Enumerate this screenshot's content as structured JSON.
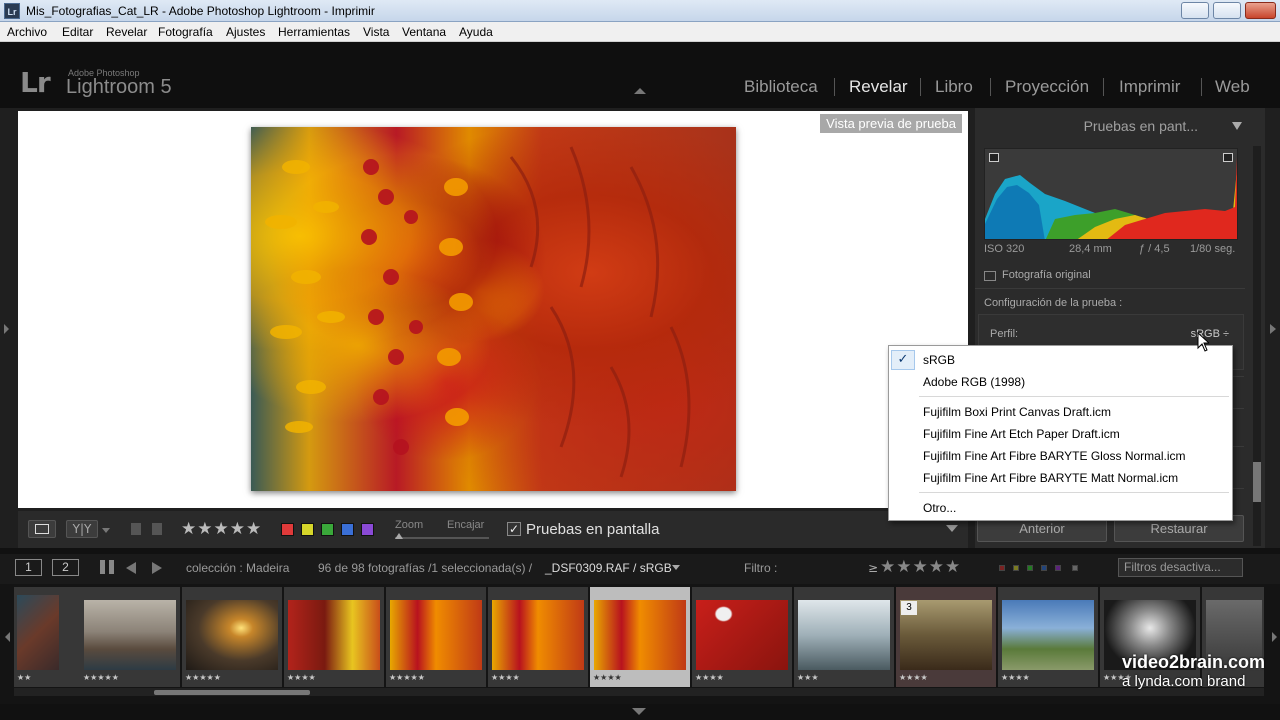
{
  "window": {
    "title": "Mis_Fotografias_Cat_LR - Adobe Photoshop Lightroom - Imprimir",
    "icon_text": "Lr"
  },
  "menubar": {
    "items": [
      "Archivo",
      "Editar",
      "Revelar",
      "Fotografía",
      "Ajustes",
      "Herramientas",
      "Vista",
      "Ventana",
      "Ayuda"
    ]
  },
  "identity": {
    "logo": "Lr",
    "brand_small": "Adobe Photoshop",
    "brand_big": "Lightroom 5"
  },
  "modules": {
    "items": [
      "Biblioteca",
      "Revelar",
      "Libro",
      "Proyección",
      "Imprimir",
      "Web"
    ],
    "active": "Revelar"
  },
  "canvas": {
    "proof_label": "Vista previa de prueba"
  },
  "toolbar": {
    "stars": "★★★★★",
    "rating": 4,
    "color_labels": [
      "#e03a3a",
      "#d6d62a",
      "#3aa83a",
      "#3a6fd6",
      "#8a4ad6"
    ],
    "zoom_label": "Zoom",
    "fit_label": "Encajar",
    "proof_check": "✓",
    "proof_label": "Pruebas en pantalla"
  },
  "right_panel": {
    "title": "Pruebas en pant...",
    "histogram": {
      "iso": "ISO 320",
      "focal": "28,4 mm",
      "aperture": "ƒ / 4,5",
      "shutter": "1/80 seg."
    },
    "original_photo_label": "Fotografía original",
    "proof_config_label": "Configuración de la prueba :",
    "profile_label": "Perfil:",
    "profile_value": "sRGB ÷",
    "prev_button": "Anterior",
    "reset_button": "Restaurar"
  },
  "profile_menu": {
    "checkmark": "✓",
    "items": [
      "sRGB",
      "Adobe RGB (1998)",
      "Fujifilm Boxi Print Canvas Draft.icm",
      "Fujifilm Fine Art Etch Paper Draft.icm",
      "Fujifilm Fine Art Fibre BARYTE Gloss Normal.icm",
      "Fujifilm Fine Art Fibre BARYTE Matt Normal.icm",
      "Otro..."
    ],
    "selected": "sRGB"
  },
  "filmstrip_bar": {
    "view1": "1",
    "view2": "2",
    "collection": "colección : Madeira",
    "count": "96 de 98 fotografías /1 seleccionada(s) /",
    "filename": "_DSF0309.RAF / sRGB",
    "filter_label": "Filtro :",
    "filter_op": "≥",
    "filter_stars": "★★★★★",
    "filters_select": "Filtros desactiva..."
  },
  "filmstrip": {
    "cells": [
      {
        "stars": "★★★★★",
        "selected": false
      },
      {
        "stars": "★★★★★",
        "selected": false
      },
      {
        "stars": "★★★★",
        "selected": false
      },
      {
        "stars": "★★★★★",
        "selected": false
      },
      {
        "stars": "★★★★",
        "selected": false
      },
      {
        "stars": "★★★★",
        "selected": true
      },
      {
        "stars": "★★★★",
        "selected": false
      },
      {
        "stars": "★★★",
        "selected": false
      },
      {
        "stars": "★★★★",
        "selected": false,
        "number": "3"
      },
      {
        "stars": "★★★★",
        "selected": false
      },
      {
        "stars": "★★★★",
        "selected": false
      }
    ]
  },
  "watermark": {
    "main": "video2brain.com",
    "sub": "a lynda.com brand"
  }
}
